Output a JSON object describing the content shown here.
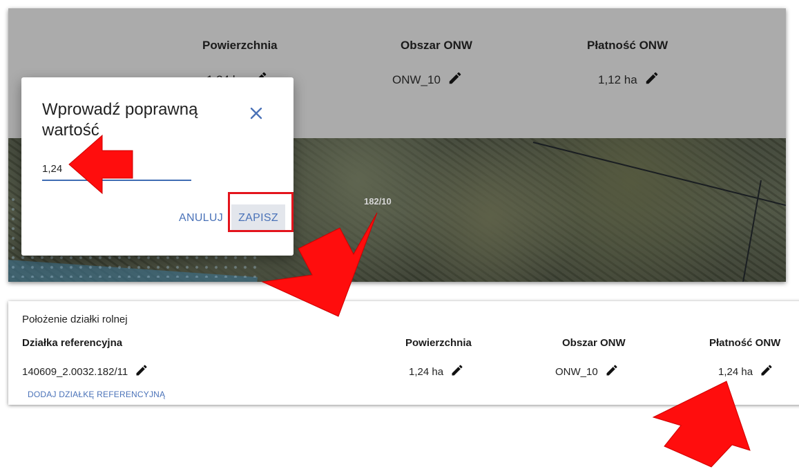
{
  "top": {
    "headers": {
      "area": "Powierzchnia",
      "onw_zone": "Obszar ONW",
      "onw_payment": "Płatność ONW"
    },
    "values": {
      "area": "1,24 ha",
      "onw_zone": "ONW_10",
      "onw_payment": "1,12 ha"
    },
    "map_label": "182/10"
  },
  "dialog": {
    "title": "Wprowadź poprawną wartość",
    "input_value": "1,24",
    "cancel_label": "ANULUJ",
    "save_label": "ZAPISZ"
  },
  "bottom": {
    "title": "Położenie działki rolnej",
    "headers": {
      "parcel": "Działka referencyjna",
      "area": "Powierzchnia",
      "onw_zone": "Obszar ONW",
      "onw_payment": "Płatność ONW"
    },
    "row": {
      "parcel": "140609_2.0032.182/11",
      "area": "1,24 ha",
      "onw_zone": "ONW_10",
      "onw_payment": "1,24 ha"
    },
    "add_link": "DODAJ DZIAŁKĘ REFERENCYJNĄ"
  },
  "colors": {
    "accent": "#4a72b8",
    "annotation": "#e3141c"
  },
  "icons": {
    "edit": "pencil-icon",
    "close": "close-icon",
    "arrow": "arrow-annotation"
  }
}
